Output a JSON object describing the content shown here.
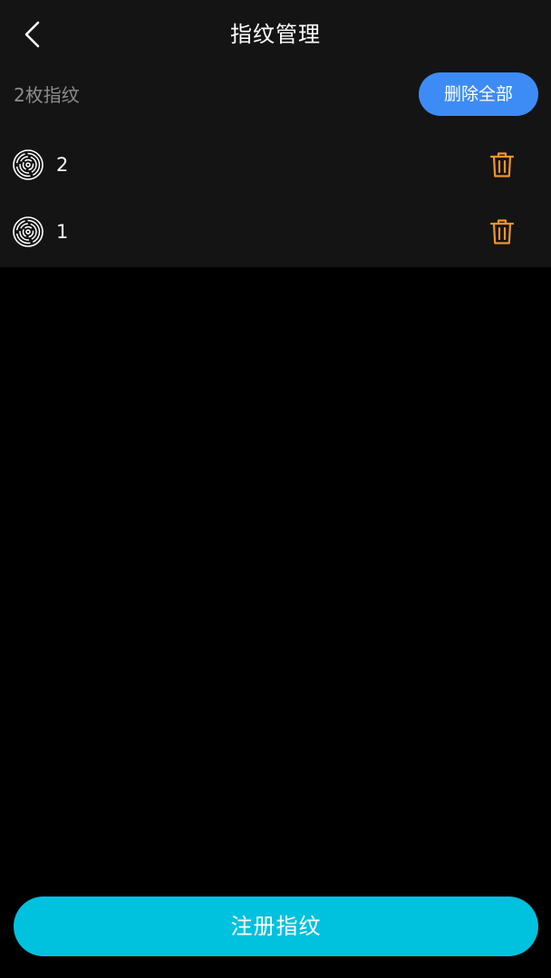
{
  "header": {
    "title": "指纹管理",
    "back_icon": "chevron-left-icon"
  },
  "summary": {
    "count_label": "2枚指纹",
    "delete_all_label": "删除全部"
  },
  "fingerprints": [
    {
      "name": "2",
      "icon": "fingerprint-icon",
      "action_icon": "trash-icon"
    },
    {
      "name": "1",
      "icon": "fingerprint-icon",
      "action_icon": "trash-icon"
    }
  ],
  "footer": {
    "register_label": "注册指纹"
  },
  "colors": {
    "page_background": "#000000",
    "panel_background": "#141414",
    "primary_blue": "#3d8cf5",
    "register_cyan": "#00c2de",
    "trash_orange": "#f0952a",
    "muted_text": "#8c8c8c"
  }
}
